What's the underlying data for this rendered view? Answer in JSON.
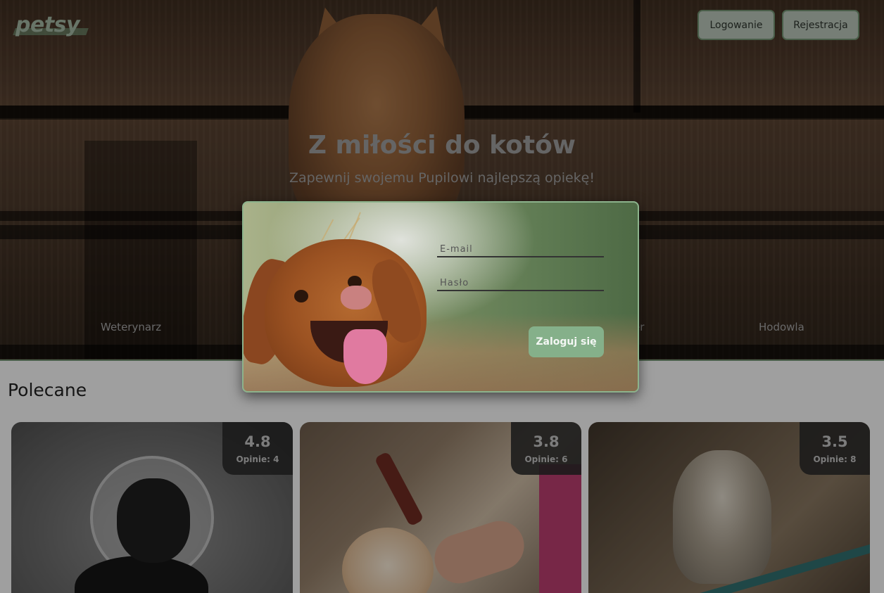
{
  "header": {
    "logo": "petsy",
    "login_button": "Logowanie",
    "register_button": "Rejestracja"
  },
  "hero": {
    "title": "Z miłości do kotów",
    "subtitle": "Zapewnij swojemu Pupilowi najlepszą opiekę!",
    "categories": [
      "Weterynarz",
      "er",
      "Hodowla"
    ]
  },
  "recommended": {
    "title": "Polecane",
    "cards": [
      {
        "rating": "4.8",
        "reviews": "Opinie: 4"
      },
      {
        "rating": "3.8",
        "reviews": "Opinie: 6"
      },
      {
        "rating": "3.5",
        "reviews": "Opinie: 8"
      }
    ]
  },
  "login_modal": {
    "email_placeholder": "E-mail",
    "password_placeholder": "Hasło",
    "submit_label": "Zaloguj się"
  },
  "colors": {
    "accent": "#85b08a",
    "accent_border": "#6f8f6f"
  }
}
